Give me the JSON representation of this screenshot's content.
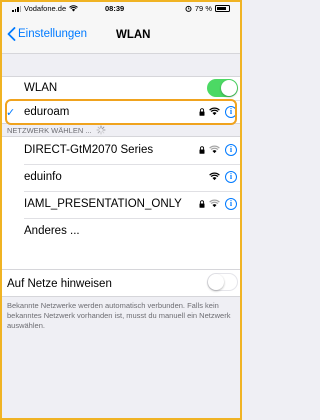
{
  "status_bar": {
    "carrier": "Vodafone.de",
    "time": "08:39",
    "battery": "79 %",
    "battery_level": 0.79
  },
  "nav": {
    "back_label": "Einstellungen",
    "title": "WLAN"
  },
  "wlan": {
    "label": "WLAN",
    "enabled": true,
    "connected_network": "eduroam"
  },
  "section_header": "NETZWERK WÄHLEN ...",
  "networks": [
    {
      "name": "DIRECT-GtM2070 Series",
      "locked": true
    },
    {
      "name": "eduinfo",
      "locked": false
    },
    {
      "name": "IAML_PRESENTATION_ONLY",
      "locked": true
    }
  ],
  "other_label": "Anderes ...",
  "ask_to_join": {
    "label": "Auf Netze hinweisen",
    "enabled": false,
    "footnote": "Bekannte Netzwerke werden automatisch verbunden. Falls kein bekanntes Netzwerk vorhanden ist, musst du manuell ein Netzwerk auswählen."
  },
  "colors": {
    "accent": "#007aff",
    "toggle_on": "#4cd964",
    "highlight": "#f0a31e"
  }
}
